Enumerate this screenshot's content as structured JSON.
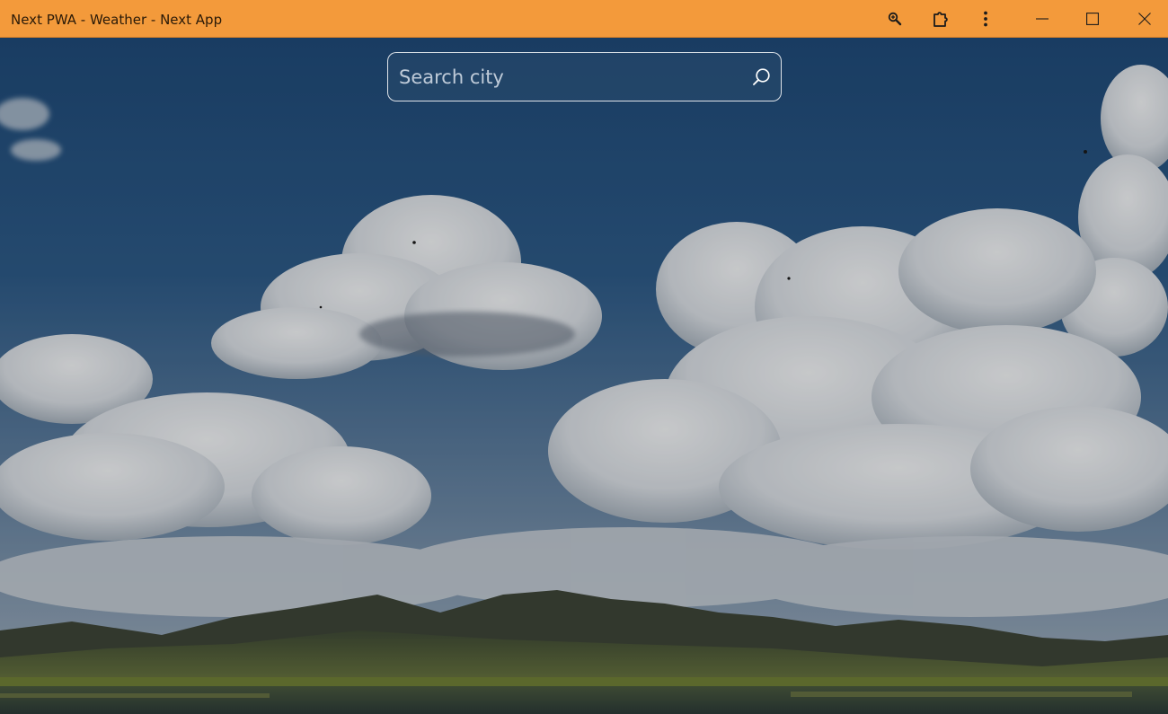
{
  "window": {
    "title": "Next PWA - Weather - Next App",
    "titlebar_color": "#f39a3b"
  },
  "titlebar": {
    "buttons": [
      {
        "name": "zoom-button",
        "icon": "magnifier-zoom-icon"
      },
      {
        "name": "extensions-button",
        "icon": "puzzle-piece-icon"
      },
      {
        "name": "more-options-button",
        "icon": "vertical-dots-icon"
      },
      {
        "name": "minimize-button",
        "icon": "minimize-icon"
      },
      {
        "name": "maximize-button",
        "icon": "maximize-icon"
      },
      {
        "name": "close-button",
        "icon": "close-icon"
      }
    ]
  },
  "search": {
    "placeholder": "Search city",
    "value": "",
    "icon": "search-icon"
  },
  "background": {
    "description_icon": "landscape-photo",
    "sky_color": "#2b5684",
    "cloud_color": "#e3e7ec",
    "hill_color": "#4f5a3a",
    "water_color": "#3c4a3a"
  }
}
